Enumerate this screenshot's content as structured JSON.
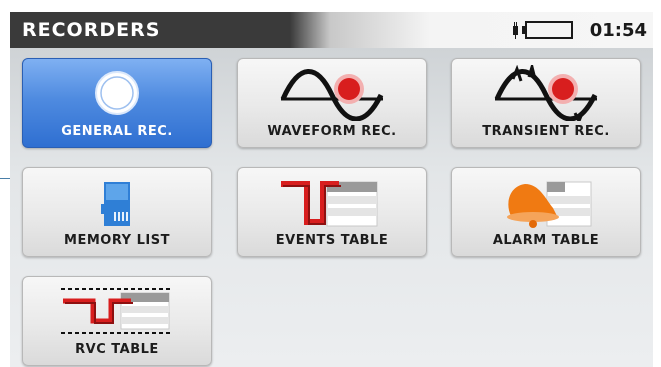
{
  "header": {
    "title": "RECORDERS",
    "time": "01:54"
  },
  "status": {
    "icons": [
      "plug-icon",
      "battery-empty-icon"
    ]
  },
  "tiles": [
    {
      "label": "GENERAL REC.",
      "icon": "record-circle-icon",
      "selected": true
    },
    {
      "label": "WAVEFORM REC.",
      "icon": "waveform-icon",
      "selected": false
    },
    {
      "label": "TRANSIENT REC.",
      "icon": "transient-icon",
      "selected": false
    },
    {
      "label": "MEMORY LIST",
      "icon": "sd-card-icon",
      "selected": false
    },
    {
      "label": "EVENTS TABLE",
      "icon": "events-table-icon",
      "selected": false
    },
    {
      "label": "ALARM TABLE",
      "icon": "alarm-bell-table-icon",
      "selected": false
    },
    {
      "label": "RVC TABLE",
      "icon": "rvc-table-icon",
      "selected": false
    }
  ],
  "colors": {
    "selected_tile": "#3b7ad8",
    "header_dark": "#3a3a3a",
    "red_accent": "#d81e1e",
    "alarm_orange": "#f07a12",
    "sd_blue": "#2f7fd6"
  }
}
